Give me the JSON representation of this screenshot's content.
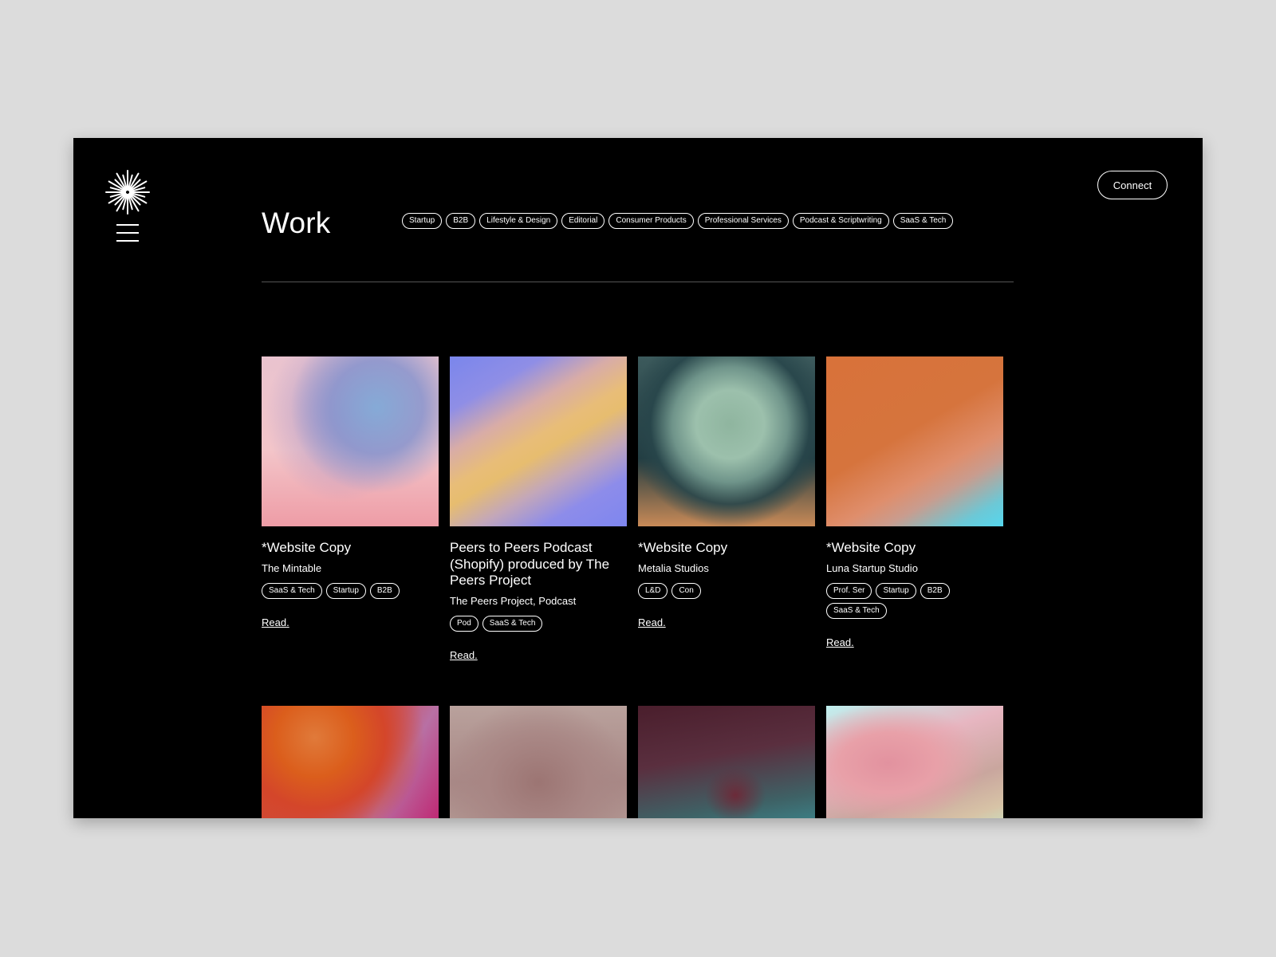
{
  "header": {
    "logo_icon": "starburst-logo-icon",
    "menu_icon": "hamburger-menu-icon",
    "connect_label": "Connect"
  },
  "page": {
    "title": "Work"
  },
  "filters": [
    "Startup",
    "B2B",
    "Lifestyle & Design",
    "Editorial",
    "Consumer Products",
    "Professional Services",
    "Podcast & Scriptwriting",
    "SaaS & Tech"
  ],
  "cards": [
    {
      "title": "*Website Copy",
      "client": "The Mintable",
      "tags": [
        "SaaS & Tech",
        "Startup",
        "B2B"
      ],
      "read_label": "Read."
    },
    {
      "title": "Peers to Peers Podcast (Shopify) produced by The Peers Project",
      "client": "The Peers Project, Podcast",
      "tags": [
        "Pod",
        "SaaS & Tech"
      ],
      "read_label": "Read."
    },
    {
      "title": "*Website Copy",
      "client": "Metalia Studios",
      "tags": [
        "L&D",
        "Con"
      ],
      "read_label": "Read."
    },
    {
      "title": "*Website Copy",
      "client": "Luna Startup Studio",
      "tags": [
        "Prof. Ser",
        "Startup",
        "B2B",
        "SaaS & Tech"
      ],
      "read_label": "Read."
    }
  ],
  "colors": {
    "background": "#000000",
    "outer_background": "#dcdcdc",
    "text": "#ffffff"
  }
}
